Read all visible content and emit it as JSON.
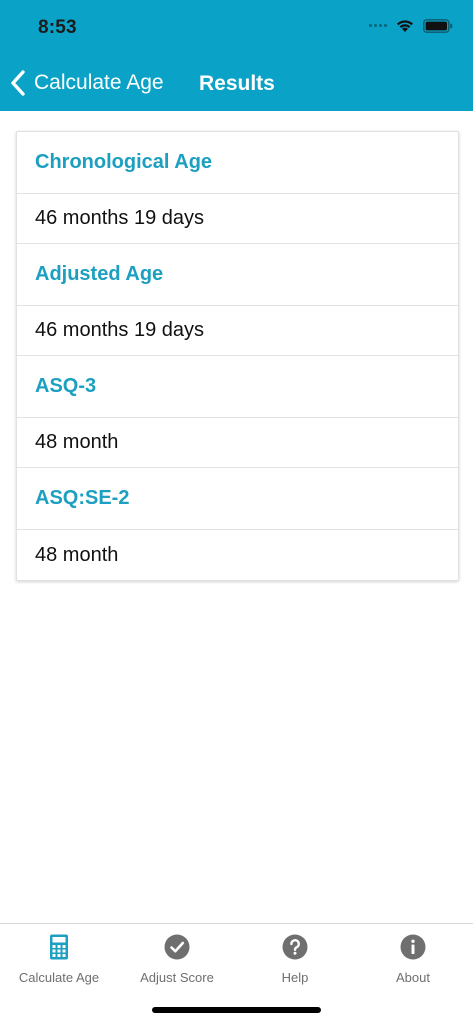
{
  "status_bar": {
    "time": "8:53"
  },
  "nav": {
    "back_label": "Calculate Age",
    "title": "Results"
  },
  "results": [
    {
      "heading": "Chronological Age",
      "value": "46 months 19 days"
    },
    {
      "heading": "Adjusted Age",
      "value": "46 months 19 days"
    },
    {
      "heading": "ASQ-3",
      "value": "48 month"
    },
    {
      "heading": "ASQ:SE-2",
      "value": "48 month"
    }
  ],
  "tabs": [
    {
      "label": "Calculate Age",
      "icon": "calculator-icon",
      "active": true
    },
    {
      "label": "Adjust Score",
      "icon": "checkmark-circle-icon",
      "active": false
    },
    {
      "label": "Help",
      "icon": "question-circle-icon",
      "active": false
    },
    {
      "label": "About",
      "icon": "info-circle-icon",
      "active": false
    }
  ],
  "colors": {
    "accent": "#0aa3c7",
    "heading": "#1c9fc0",
    "tab_inactive": "#6f6f6f"
  }
}
